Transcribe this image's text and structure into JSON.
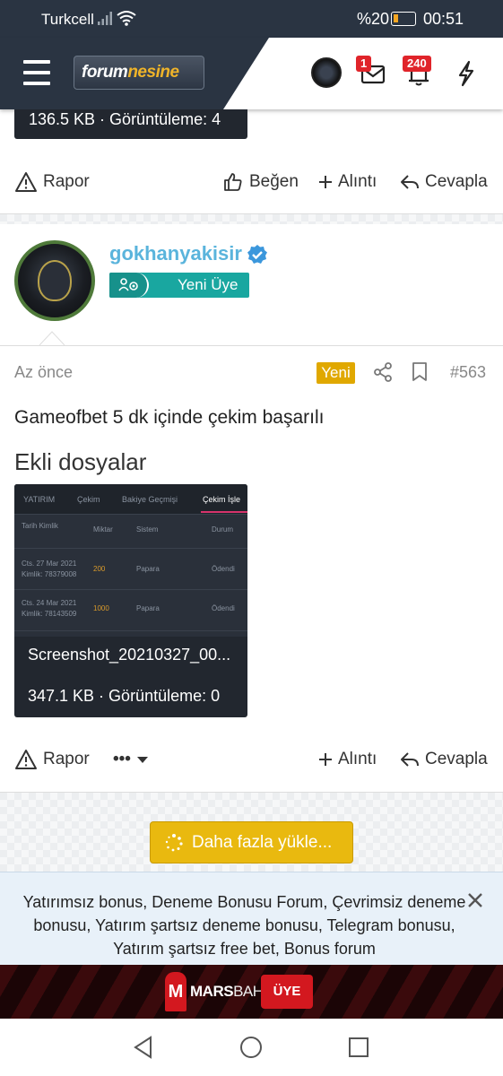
{
  "status_bar": {
    "carrier": "Turkcell",
    "battery_percent": "%20",
    "time": "00:51"
  },
  "header": {
    "logo_text_a": "forum",
    "logo_text_b": "nesine",
    "messages_badge": "1",
    "alerts_badge": "240"
  },
  "previous_post": {
    "attachment_meta": "136.5 KB · Görüntüleme: 4",
    "actions": {
      "report": "Rapor",
      "like": "Beğen",
      "quote": "Alıntı",
      "reply": "Cevapla"
    }
  },
  "post": {
    "username": "gokhanyakisir",
    "user_title": "Yeni Üye",
    "time_ago": "Az önce",
    "new_label": "Yeni",
    "post_number": "#563",
    "body": "Gameofbet 5 dk içinde çekim başarılı",
    "attachments_heading": "Ekli dosyalar",
    "attachment": {
      "filename": "Screenshot_20210327_00...",
      "meta": "347.1 KB · Görüntüleme: 0",
      "thumbnail": {
        "tabs": [
          "YATIRIM",
          "Çekim",
          "Bakiye Geçmişi",
          "Çekim İşle"
        ],
        "columns": [
          "Tarih Kimlik",
          "Miktar",
          "Sistem",
          "Durum"
        ],
        "rows": [
          {
            "date": "Cts. 27 Mar 2021",
            "id": "Kimlik: 78379008",
            "amount": "200",
            "system": "Papara",
            "status": "Ödendi"
          },
          {
            "date": "Cts. 24 Mar 2021",
            "id": "Kimlik: 78143509",
            "amount": "1000",
            "system": "Papara",
            "status": "Ödendi"
          }
        ]
      }
    },
    "actions": {
      "report": "Rapor",
      "more": "•••",
      "quote": "Alıntı",
      "reply": "Cevapla"
    }
  },
  "load_more": "Daha fazla yükle...",
  "notice": "Yatırımsız bonus, Deneme Bonusu Forum, Çevrimsiz deneme bonusu, Yatırım şartsız deneme bonusu, Telegram bonusu, Yatırım şartsız free bet, Bonus forum",
  "banner": {
    "logo_letter": "M",
    "brand_a": "MARS",
    "brand_b": "BAHIS",
    "cta": "ÜYE OL!"
  },
  "colors": {
    "header_dark": "#2a3442",
    "username": "#5ab4dc",
    "user_badge": "#19a7a0",
    "new_badge": "#e0a800",
    "load_more": "#e9b90f",
    "notification_badge": "#e0242a"
  }
}
